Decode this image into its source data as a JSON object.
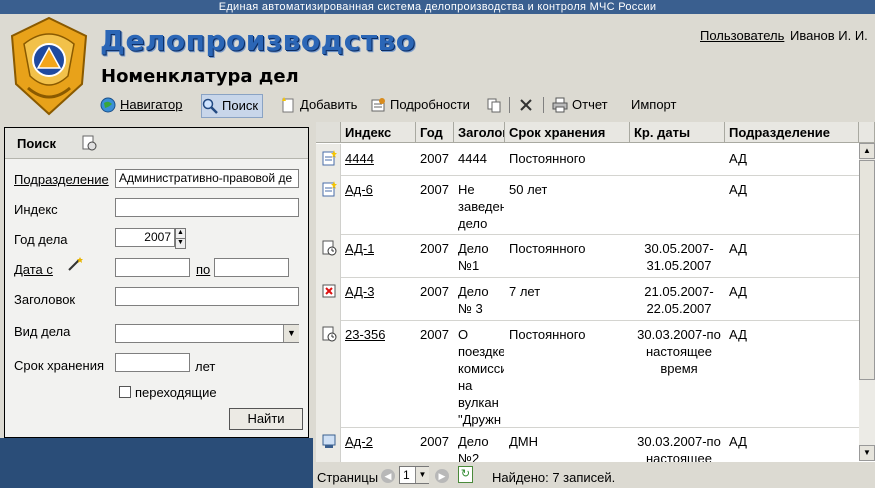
{
  "banner": "Единая автоматизированная система делопроизводства и контроля МЧС России",
  "app_title": "Делопроизводство",
  "page_title": "Номенклатура дел",
  "user": {
    "label": "Пользователь",
    "name": "Иванов И. И."
  },
  "toolbar": {
    "navigator": "Навигатор",
    "search": "Поиск",
    "add": "Добавить",
    "details": "Подробности",
    "report": "Отчет",
    "import": "Импорт"
  },
  "search": {
    "title": "Поиск",
    "division_label": "Подразделение",
    "division_value": "Административно-правовой де",
    "index_label": "Индекс",
    "year_label": "Год дела",
    "year_value": "2007",
    "date_from_label": "Дата с",
    "date_to_label": "по",
    "heading_label": "Заголовок",
    "kind_label": "Вид дела",
    "retention_label": "Срок хранения",
    "years_unit": "лет",
    "transitional_label": "переходящие",
    "find_button": "Найти"
  },
  "table": {
    "columns": [
      "Индекс",
      "Год",
      "Заголовок",
      "Срок хранения",
      "Кр. даты",
      "Подразделение"
    ],
    "rows": [
      {
        "icon": "new-doc-icon",
        "index": "4444",
        "year": "2007",
        "title": "4444",
        "retention": "Постоянного",
        "dates": "",
        "division": "АД"
      },
      {
        "icon": "new-doc-icon",
        "index": "Ад-6",
        "year": "2007",
        "title": "Не заведен дело",
        "retention": "50 лет",
        "dates": "",
        "division": "АД"
      },
      {
        "icon": "clock-doc-icon",
        "index": "АД-1",
        "year": "2007",
        "title": "Дело №1",
        "retention": "Постоянного",
        "dates": "30.05.2007-31.05.2007",
        "division": "АД"
      },
      {
        "icon": "closed-doc-icon",
        "index": "АД-3",
        "year": "2007",
        "title": "Дело № 3",
        "retention": "7 лет",
        "dates": "21.05.2007-22.05.2007",
        "division": "АД"
      },
      {
        "icon": "clock-doc-icon",
        "index": "23-356",
        "year": "2007",
        "title": "О поездке комисси на вулкан \"Дружн",
        "retention": "Постоянного",
        "dates": "30.03.2007-по настоящее время",
        "division": "АД"
      },
      {
        "icon": "archive-doc-icon",
        "index": "Ад-2",
        "year": "2007",
        "title": "Дело №2",
        "retention": "ДМН",
        "dates": "30.03.2007-по настоящее",
        "division": "АД"
      }
    ]
  },
  "pager": {
    "label": "Страницы",
    "page": "1",
    "found": "Найдено: 7 записей."
  },
  "colors": {
    "accent": "#2b66b6",
    "banner": "#3a5f8f",
    "panel_bg": "#dcdad2",
    "bottom_strip": "#2a4d78"
  }
}
